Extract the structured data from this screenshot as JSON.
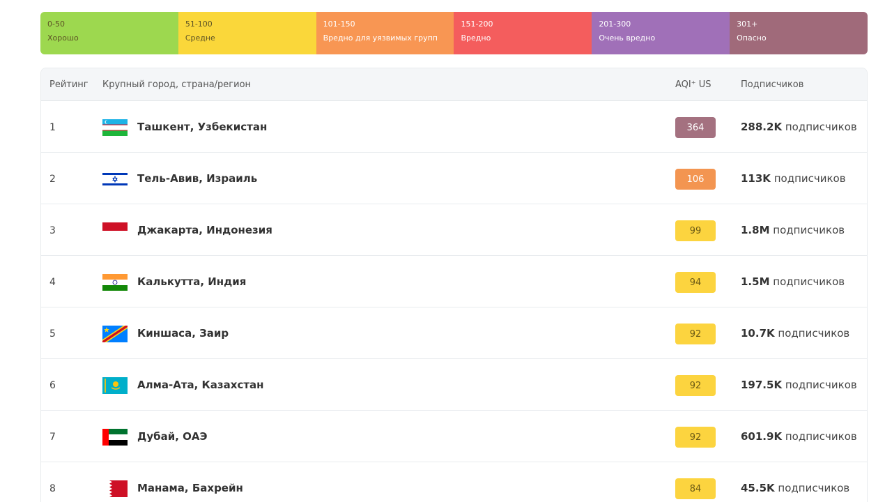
{
  "legend": [
    {
      "range": "0-50",
      "label": "Хорошо",
      "color": "#9dd84f"
    },
    {
      "range": "51-100",
      "label": "Средне",
      "color": "#fad73a"
    },
    {
      "range": "101-150",
      "label": "Вредно для уязвимых групп",
      "color": "#f89653"
    },
    {
      "range": "151-200",
      "label": "Вредно",
      "color": "#f45d5d"
    },
    {
      "range": "201-300",
      "label": "Очень вредно",
      "color": "#a070b8"
    },
    {
      "range": "301+",
      "label": "Опасно",
      "color": "#a06a7a"
    }
  ],
  "table": {
    "headers": {
      "rank": "Рейтинг",
      "city": "Крупный город, страна/регион",
      "aqi": "AQI⁺ US",
      "subs": "Подписчиков"
    },
    "subs_suffix": "подписчиков",
    "rows": [
      {
        "rank": "1",
        "city": "Ташкент, Узбекистан",
        "aqi": "364",
        "level": "maroon",
        "subs": "288.2K",
        "flag": "uzbekistan-flag-icon"
      },
      {
        "rank": "2",
        "city": "Тель-Авив, Израиль",
        "aqi": "106",
        "level": "orange",
        "subs": "113K",
        "flag": "israel-flag-icon"
      },
      {
        "rank": "3",
        "city": "Джакарта, Индонезия",
        "aqi": "99",
        "level": "yellow",
        "subs": "1.8M",
        "flag": "indonesia-flag-icon"
      },
      {
        "rank": "4",
        "city": "Калькутта, Индия",
        "aqi": "94",
        "level": "yellow",
        "subs": "1.5M",
        "flag": "india-flag-icon"
      },
      {
        "rank": "5",
        "city": "Киншаса, Заир",
        "aqi": "92",
        "level": "yellow",
        "subs": "10.7K",
        "flag": "drc-flag-icon"
      },
      {
        "rank": "6",
        "city": "Алма-Ата, Казахстан",
        "aqi": "92",
        "level": "yellow",
        "subs": "197.5K",
        "flag": "kazakhstan-flag-icon"
      },
      {
        "rank": "7",
        "city": "Дубай, ОАЭ",
        "aqi": "92",
        "level": "yellow",
        "subs": "601.9K",
        "flag": "uae-flag-icon"
      },
      {
        "rank": "8",
        "city": "Манама, Бахрейн",
        "aqi": "84",
        "level": "yellow",
        "subs": "45.5K",
        "flag": "bahrain-flag-icon"
      }
    ]
  }
}
